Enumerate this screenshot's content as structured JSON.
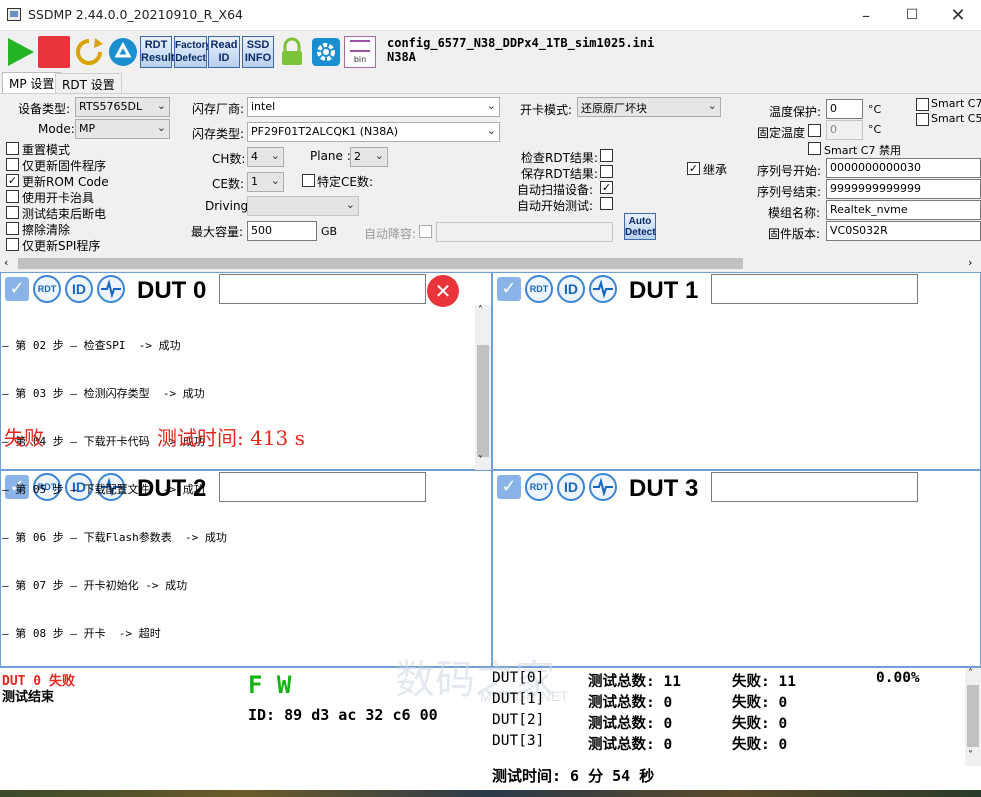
{
  "window": {
    "title": "SSDMP 2.44.0.0_20210910_R_X64"
  },
  "toolbar": {
    "rdt_result": [
      "RDT",
      "Result"
    ],
    "factory_defect": [
      "Factory",
      "Defect"
    ],
    "read_id": [
      "Read",
      "ID"
    ],
    "ssd_info": [
      "SSD",
      "INFO"
    ],
    "bin_label": "bin",
    "config_file": "config_6577_N38_DDPx4_1TB_sim1025.ini",
    "config_sub": "N38A"
  },
  "tabs": [
    {
      "label": "MP 设置"
    },
    {
      "label": "RDT 设置"
    }
  ],
  "settings": {
    "device_type_label": "设备类型:",
    "device_type": "RTS5765DL",
    "mode_label": "Mode:",
    "mode": "MP",
    "checks": [
      {
        "label": "重置模式",
        "checked": false
      },
      {
        "label": "仅更新固件程序",
        "checked": false
      },
      {
        "label": "更新ROM Code",
        "checked": true
      },
      {
        "label": "使用开卡治具",
        "checked": false
      },
      {
        "label": "测试结束后断电",
        "checked": false
      },
      {
        "label": "擦除清除",
        "checked": false
      },
      {
        "label": "仅更新SPI程序",
        "checked": false
      }
    ],
    "flash_vendor_label": "闪存厂商:",
    "flash_vendor": "intel",
    "flash_type_label": "闪存类型:",
    "flash_type": "PF29F01T2ALCQK1 (N38A)",
    "ch_label": "CH数:",
    "ch": "4",
    "plane_label": "Plane :",
    "plane": "2",
    "ce_label": "CE数:",
    "ce": "1",
    "specific_ce_label": "特定CE数:",
    "driving_label": "Driving:",
    "driving": "",
    "max_cap_label": "最大容量:",
    "max_cap": "500",
    "max_cap_unit": "GB",
    "auto_derate_label": "自动降容:",
    "open_mode_label": "开卡模式:",
    "open_mode": "还原原厂坏块",
    "check_rdt_label": "检查RDT结果:",
    "save_rdt_label": "保存RDT结果:",
    "auto_scan_label": "自动扫描设备:",
    "auto_start_label": "自动开始测试:",
    "auto_scan_checked": true,
    "inherit_label": "继承",
    "auto_detect": [
      "Auto",
      "Detect"
    ],
    "temp_protect_label": "温度保护:",
    "temp_protect": "0",
    "temp_unit": "°C",
    "fixed_temp_label": "固定温度",
    "fixed_temp": "0",
    "smart_c7_label": "Smart C7",
    "smart_c5_label": "Smart C5/",
    "smart_c7_disable_label": "Smart C7 禁用",
    "sn_start_label": "序列号开始:",
    "sn_start": "0000000000030",
    "sn_end_label": "序列号结束:",
    "sn_end": "9999999999999",
    "model_label": "模组名称:",
    "model": "Realtek_nvme",
    "fw_label": "固件版本:",
    "fw": "VC0S032R"
  },
  "duts": [
    {
      "name": "DUT 0",
      "log": [
        "— 第 02 步 — 检查SPI  -> 成功",
        "— 第 03 步 — 检测闪存类型  -> 成功",
        "— 第 04 步 — 下载开卡代码  -> 成功",
        "— 第 05 步 — 下载配置文件  -> 成功",
        "— 第 06 步 — 下载Flash参数表  -> 成功",
        "— 第 07 步 — 开卡初始化 -> 成功",
        "— 第 08 步 — 开卡  -> 超时"
      ],
      "result": "失败",
      "test_time": "测试时间: 413 s"
    },
    {
      "name": "DUT 1"
    },
    {
      "name": "DUT 2"
    },
    {
      "name": "DUT 3"
    }
  ],
  "icons": {
    "rdt": "RDT",
    "id": "ID"
  },
  "bottom": {
    "dut_status": "DUT 0",
    "dut_status_result": "失败",
    "test_end": "测试结束",
    "fw_label": "F W",
    "id_line": "ID: 89 d3 ac 32 c6 00",
    "stats": [
      {
        "dut": "DUT[0]",
        "total": "测试总数: 11",
        "fail": "失败: 11",
        "rate": "0.00%"
      },
      {
        "dut": "DUT[1]",
        "total": "测试总数: 0",
        "fail": "失败: 0",
        "rate": ""
      },
      {
        "dut": "DUT[2]",
        "total": "测试总数: 0",
        "fail": "失败: 0",
        "rate": ""
      },
      {
        "dut": "DUT[3]",
        "total": "测试总数: 0",
        "fail": "失败: 0",
        "rate": ""
      }
    ],
    "total_time": "测试时间: 6 分 54 秒",
    "watermark": "数码之家",
    "watermark_sub": "MYDIGIT.NET"
  },
  "colors": {
    "accent": "#3a86d6",
    "fail": "#e8261b",
    "fw_green": "#14b414"
  }
}
